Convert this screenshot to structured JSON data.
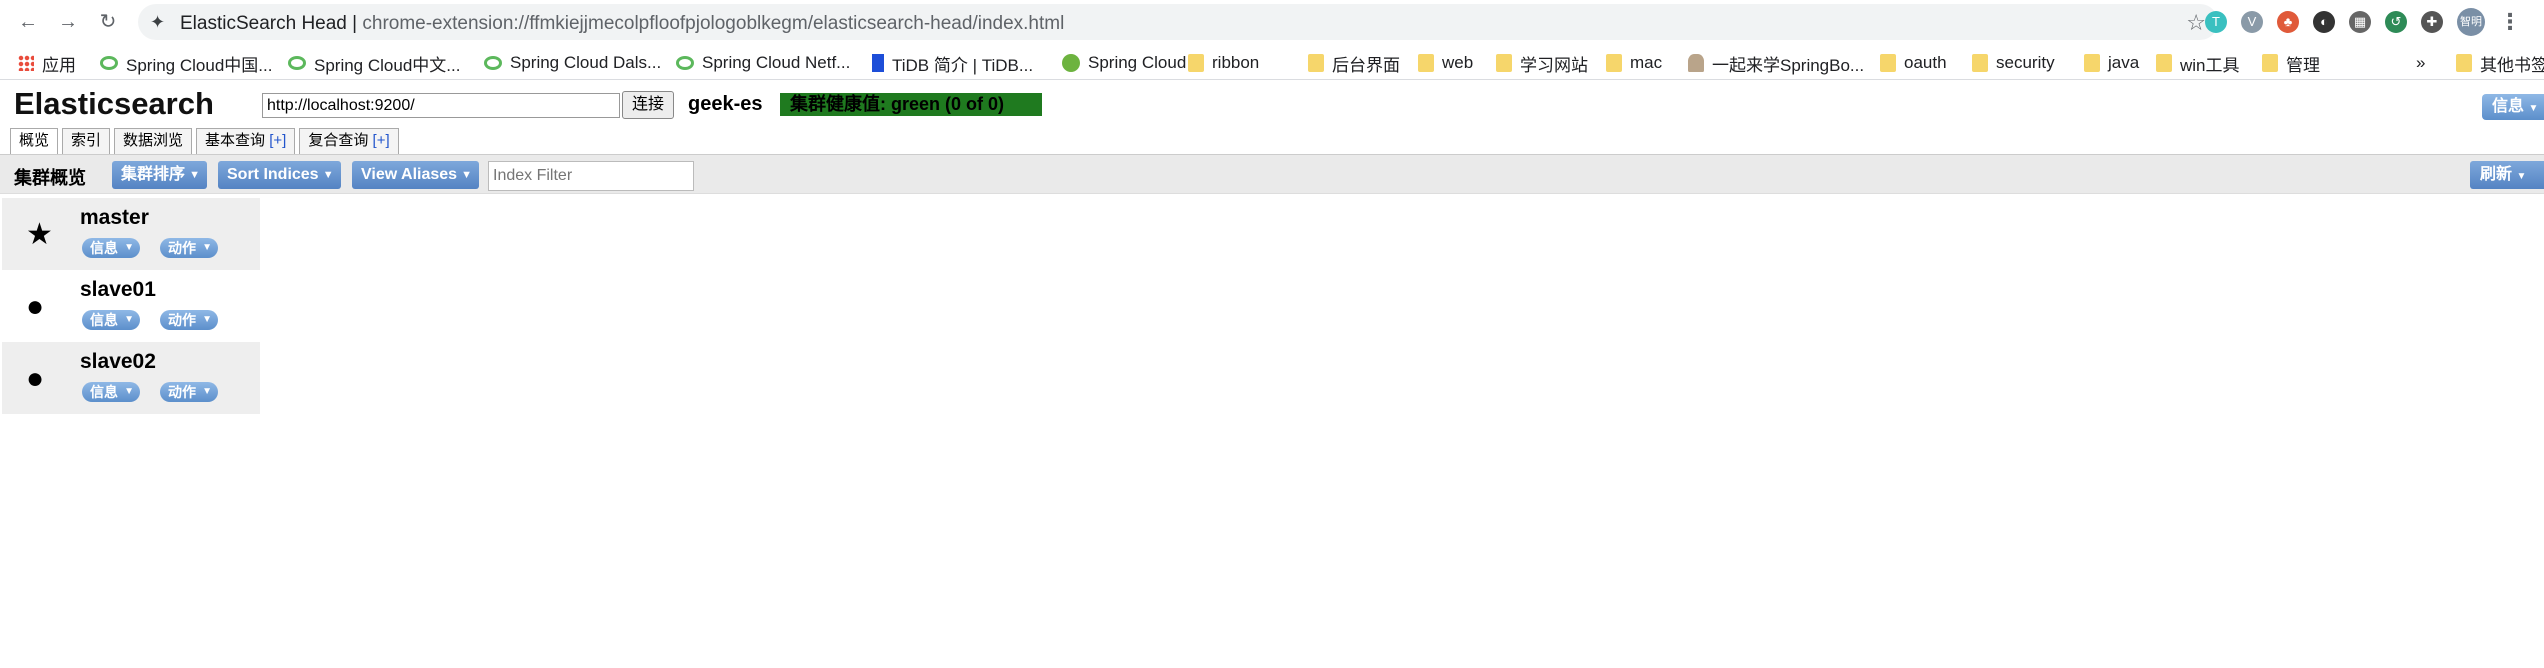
{
  "browser": {
    "page_title": "ElasticSearch Head",
    "url": "chrome-extension://ffmkiejjmecolpfloofpjologoblkegm/elasticsearch-head/index.html",
    "profile_label": "智明",
    "bookmarks": [
      {
        "label": "应用",
        "icon": "apps-grid-icon"
      },
      {
        "label": "Spring Cloud中国...",
        "icon": "spring-leaf-icon"
      },
      {
        "label": "Spring Cloud中文...",
        "icon": "spring-leaf-icon"
      },
      {
        "label": "Spring Cloud Dals...",
        "icon": "spring-leaf-icon"
      },
      {
        "label": "Spring Cloud Netf...",
        "icon": "spring-leaf-icon"
      },
      {
        "label": "TiDB 简介 | TiDB...",
        "icon": "tidb-icon"
      },
      {
        "label": "Spring Cloud",
        "icon": "spring-icon"
      },
      {
        "label": "ribbon",
        "icon": "folder-icon"
      },
      {
        "label": "后台界面",
        "icon": "folder-icon"
      },
      {
        "label": "web",
        "icon": "folder-icon"
      },
      {
        "label": "学习网站",
        "icon": "folder-icon"
      },
      {
        "label": "mac",
        "icon": "folder-icon"
      },
      {
        "label": "一起来学SpringBo...",
        "icon": "avatar-icon"
      },
      {
        "label": "oauth",
        "icon": "folder-icon"
      },
      {
        "label": "security",
        "icon": "folder-icon"
      },
      {
        "label": "java",
        "icon": "folder-icon"
      },
      {
        "label": "win工具",
        "icon": "folder-icon"
      },
      {
        "label": "管理",
        "icon": "folder-icon"
      }
    ],
    "overflow": "»",
    "other_bookmarks": "其他书签"
  },
  "app": {
    "brand": "Elasticsearch",
    "connection_url": "http://localhost:9200/",
    "connect_label": "连接",
    "cluster_name": "geek-es",
    "health_text": "集群健康值: green (0 of 0)",
    "health_color": "#1f7a1f",
    "info_label": "信息",
    "tabs": [
      {
        "label": "概览",
        "plus": ""
      },
      {
        "label": "索引",
        "plus": ""
      },
      {
        "label": "数据浏览",
        "plus": ""
      },
      {
        "label": "基本查询",
        "plus": "[+]"
      },
      {
        "label": "复合查询",
        "plus": "[+]"
      }
    ],
    "toolbar": {
      "title": "集群概览",
      "sort_cluster": "集群排序",
      "sort_indices": "Sort Indices",
      "view_aliases": "View Aliases",
      "index_filter_placeholder": "Index Filter",
      "refresh": "刷新"
    },
    "nodes": [
      {
        "name": "master",
        "icon": "star-icon",
        "info": "信息",
        "action": "动作"
      },
      {
        "name": "slave01",
        "icon": "circle-icon",
        "info": "信息",
        "action": "动作"
      },
      {
        "name": "slave02",
        "icon": "circle-icon",
        "info": "信息",
        "action": "动作"
      }
    ]
  }
}
